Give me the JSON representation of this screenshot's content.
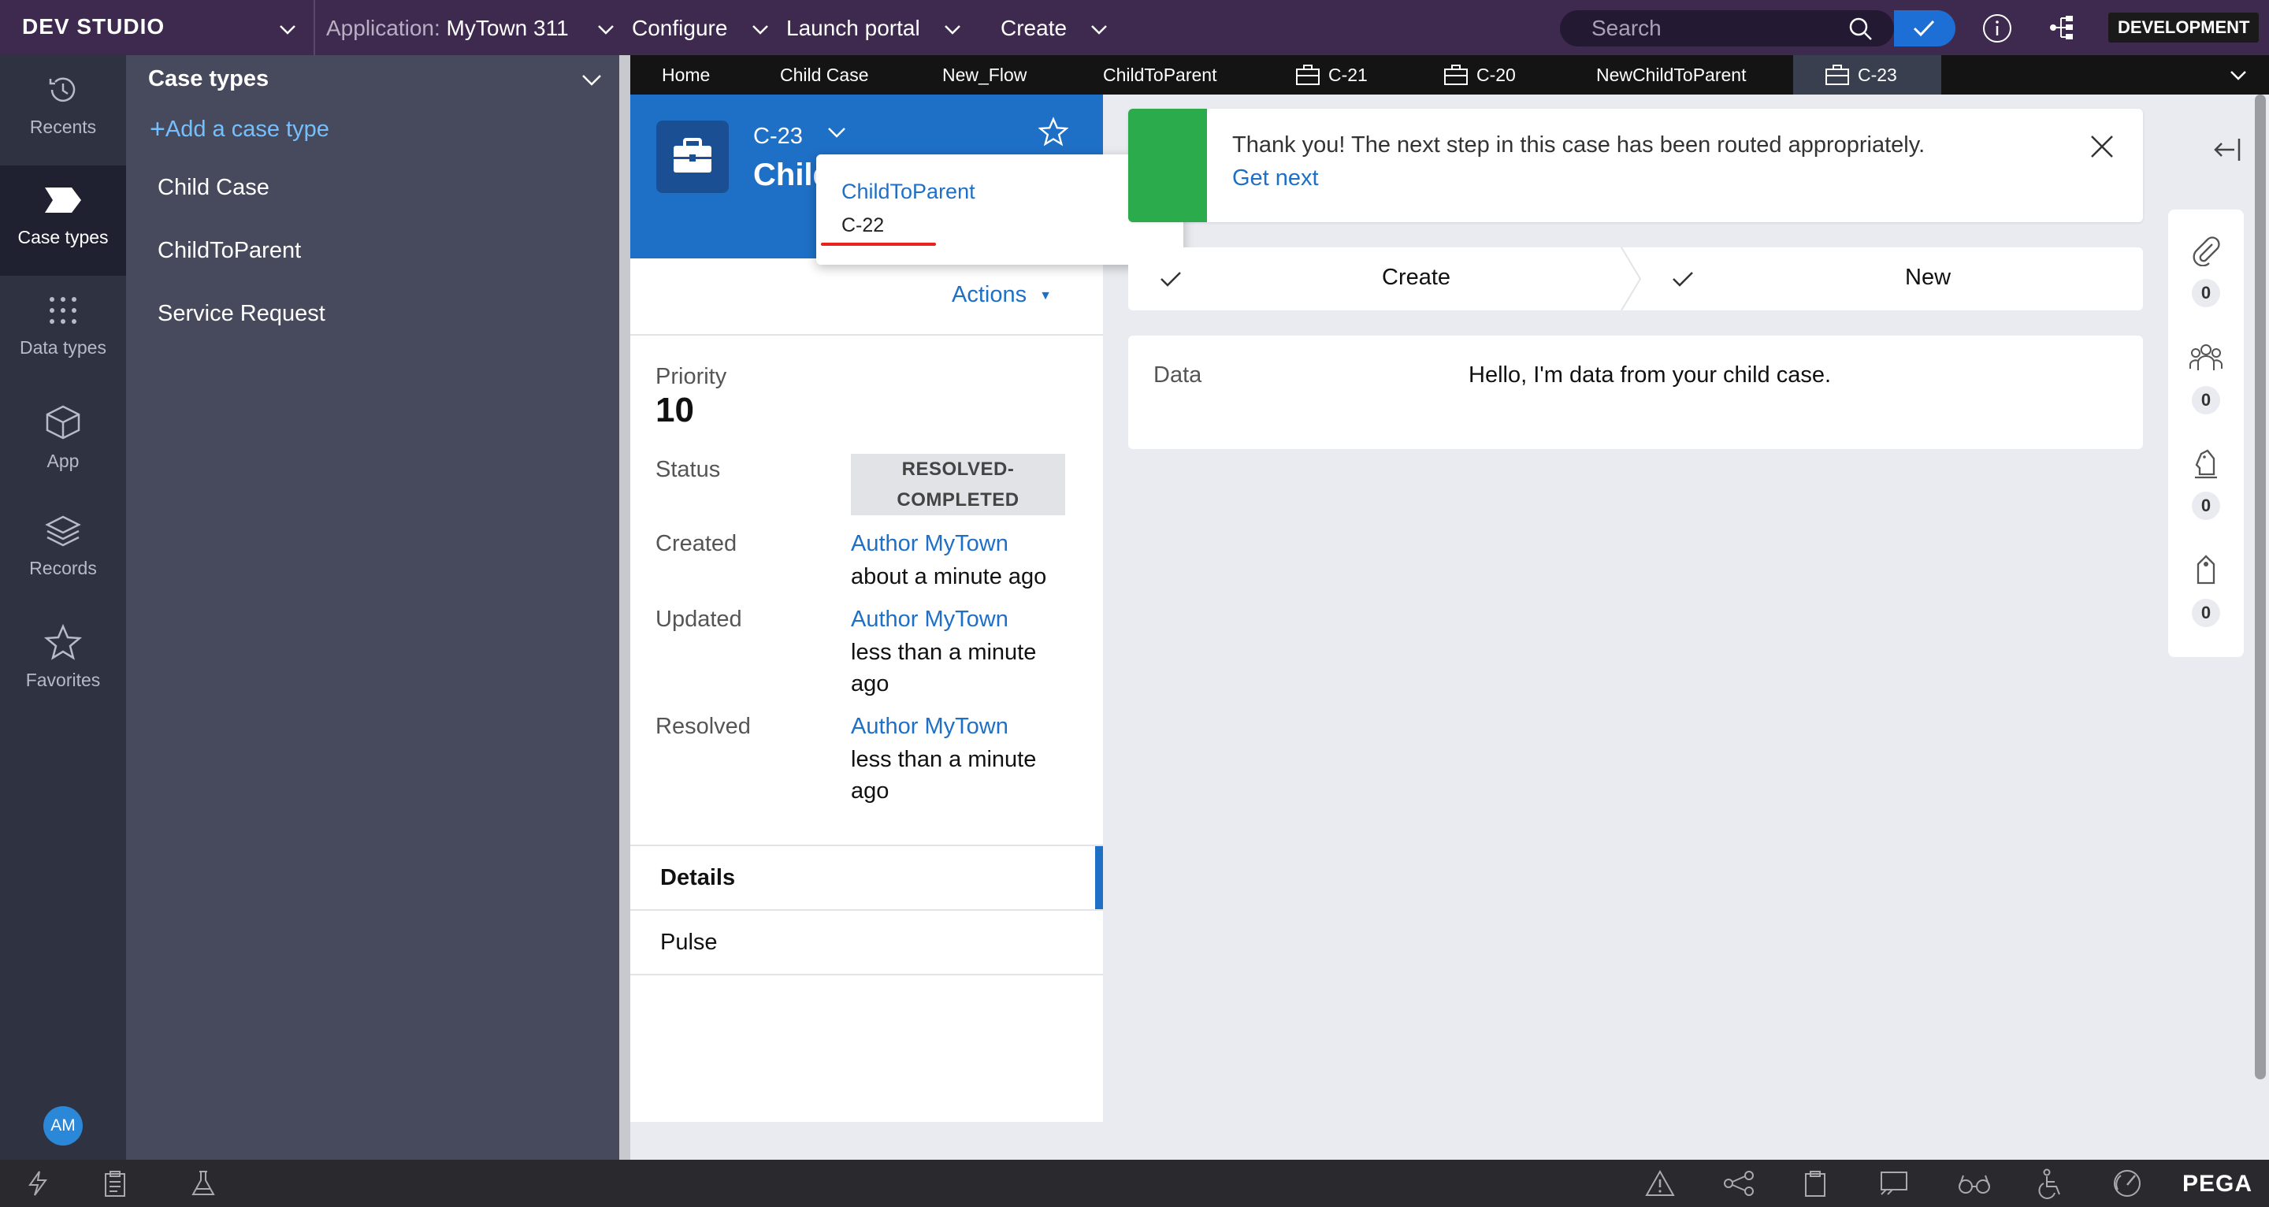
{
  "topbar": {
    "brand": "DEV STUDIO",
    "application_prefix": "Application:",
    "application_name": "MyTown 311",
    "configure": "Configure",
    "launch_portal": "Launch portal",
    "create": "Create",
    "search_placeholder": "Search",
    "environment": "DEVELOPMENT"
  },
  "rail": {
    "items": [
      {
        "label": "Recents",
        "icon": "history-icon"
      },
      {
        "label": "Case types",
        "icon": "case-type-icon"
      },
      {
        "label": "Data types",
        "icon": "grid-dots-icon"
      },
      {
        "label": "App",
        "icon": "cube-icon"
      },
      {
        "label": "Records",
        "icon": "layers-icon"
      },
      {
        "label": "Favorites",
        "icon": "star-icon"
      }
    ],
    "avatar_initials": "AM"
  },
  "case_panel": {
    "title": "Case types",
    "add_link": "Add a case type",
    "items": [
      "Child Case",
      "ChildToParent",
      "Service Request"
    ]
  },
  "tabs": [
    {
      "label": "Home"
    },
    {
      "label": "Child Case"
    },
    {
      "label": "New_Flow"
    },
    {
      "label": "ChildToParent"
    },
    {
      "label": "C-21"
    },
    {
      "label": "C-20"
    },
    {
      "label": "NewChildToParent"
    },
    {
      "label": "C-23"
    }
  ],
  "case": {
    "id": "C-23",
    "name_visible": "Child",
    "actions": "Actions",
    "popover": {
      "parent_type": "ChildToParent",
      "parent_id": "C-22"
    },
    "priority_label": "Priority",
    "priority_value": "10",
    "status_label": "Status",
    "status_line1": "RESOLVED-",
    "status_line2": "COMPLETED",
    "created_label": "Created",
    "created_by": "Author MyTown",
    "created_when": "about a minute ago",
    "updated_label": "Updated",
    "updated_by": "Author MyTown",
    "updated_when_1": "less than a minute",
    "updated_when_2": "ago",
    "resolved_label": "Resolved",
    "resolved_by": "Author MyTown",
    "resolved_when_1": "less than a minute",
    "resolved_when_2": "ago",
    "subnav": [
      "Details",
      "Pulse"
    ]
  },
  "banner": {
    "message": "Thank you! The next step in this case has been routed appropriately.",
    "link": "Get next"
  },
  "stages": [
    "Create",
    "New"
  ],
  "data_card": {
    "label": "Data",
    "value": "Hello, I'm data from your child case."
  },
  "utility_counts": {
    "attachments": "0",
    "followers": "0",
    "stakeholders": "0",
    "tags": "0"
  },
  "footer": {
    "brand": "PEGA"
  },
  "colors": {
    "topbar": "#3e2a4f",
    "accent": "#1e6fc6",
    "success": "#2bab4b"
  }
}
